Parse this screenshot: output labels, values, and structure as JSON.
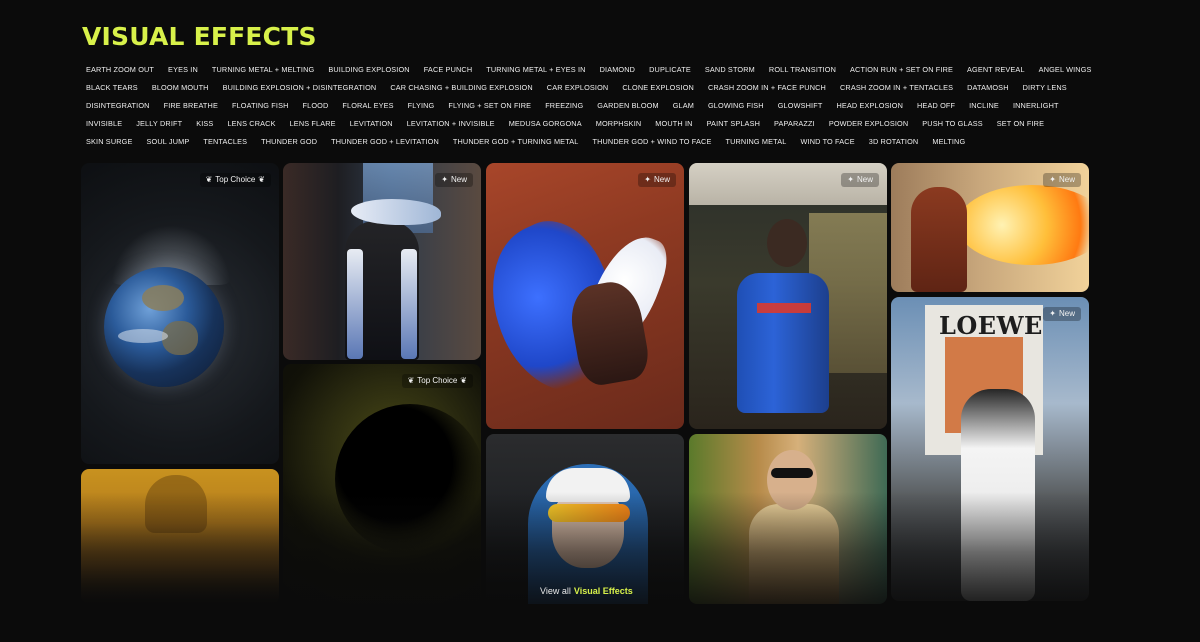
{
  "section": {
    "title": "VISUAL EFFECTS"
  },
  "tags": [
    "EARTH ZOOM OUT",
    "EYES IN",
    "TURNING METAL + MELTING",
    "BUILDING EXPLOSION",
    "FACE PUNCH",
    "TURNING METAL + EYES IN",
    "DIAMOND",
    "DUPLICATE",
    "SAND STORM",
    "ROLL TRANSITION",
    "ACTION RUN + SET ON FIRE",
    "AGENT REVEAL",
    "ANGEL WINGS",
    "BLACK TEARS",
    "BLOOM MOUTH",
    "BUILDING EXPLOSION + DISINTEGRATION",
    "CAR CHASING + BUILDING EXPLOSION",
    "CAR EXPLOSION",
    "CLONE EXPLOSION",
    "CRASH ZOOM IN + FACE PUNCH",
    "CRASH ZOOM IN + TENTACLES",
    "DATAMOSH",
    "DIRTY LENS",
    "DISINTEGRATION",
    "FIRE BREATHE",
    "FLOATING FISH",
    "FLOOD",
    "FLORAL EYES",
    "FLYING",
    "FLYING + SET ON FIRE",
    "FREEZING",
    "GARDEN BLOOM",
    "GLAM",
    "GLOWING FISH",
    "GLOWSHIFT",
    "HEAD EXPLOSION",
    "HEAD OFF",
    "INCLINE",
    "INNERLIGHT",
    "INVISIBLE",
    "JELLY DRIFT",
    "KISS",
    "LENS CRACK",
    "LENS FLARE",
    "LEVITATION",
    "LEVITATION + INVISIBLE",
    "MEDUSA GORGONA",
    "MORPHSKIN",
    "MOUTH IN",
    "PAINT SPLASH",
    "PAPARAZZI",
    "POWDER EXPLOSION",
    "PUSH TO GLASS",
    "SET ON FIRE",
    "SKIN SURGE",
    "SOUL JUMP",
    "TENTACLES",
    "THUNDER GOD",
    "THUNDER GOD + LEVITATION",
    "THUNDER GOD + TURNING METAL",
    "THUNDER GOD + WIND TO FACE",
    "TURNING METAL",
    "WIND TO FACE",
    "3D ROTATION",
    "MELTING"
  ],
  "cards": [
    {
      "badge": "Top Choice",
      "badge_icon": "laurel-icon"
    },
    {
      "badge": "New",
      "badge_icon": "sparkle-icon"
    },
    {
      "badge": "New",
      "badge_icon": "sparkle-icon"
    },
    {
      "badge": "New",
      "badge_icon": "sparkle-icon"
    },
    {
      "badge": "New",
      "badge_icon": "sparkle-icon"
    },
    {
      "badge": "New",
      "badge_icon": "sparkle-icon"
    },
    {
      "badge": "Top Choice",
      "badge_icon": "laurel-icon"
    }
  ],
  "art": {
    "billboard_text": "LOEWE"
  },
  "view_all": {
    "prefix": "View all",
    "target": "Visual Effects"
  },
  "colors": {
    "accent": "#d8f14a",
    "background": "#0b0b0b"
  }
}
